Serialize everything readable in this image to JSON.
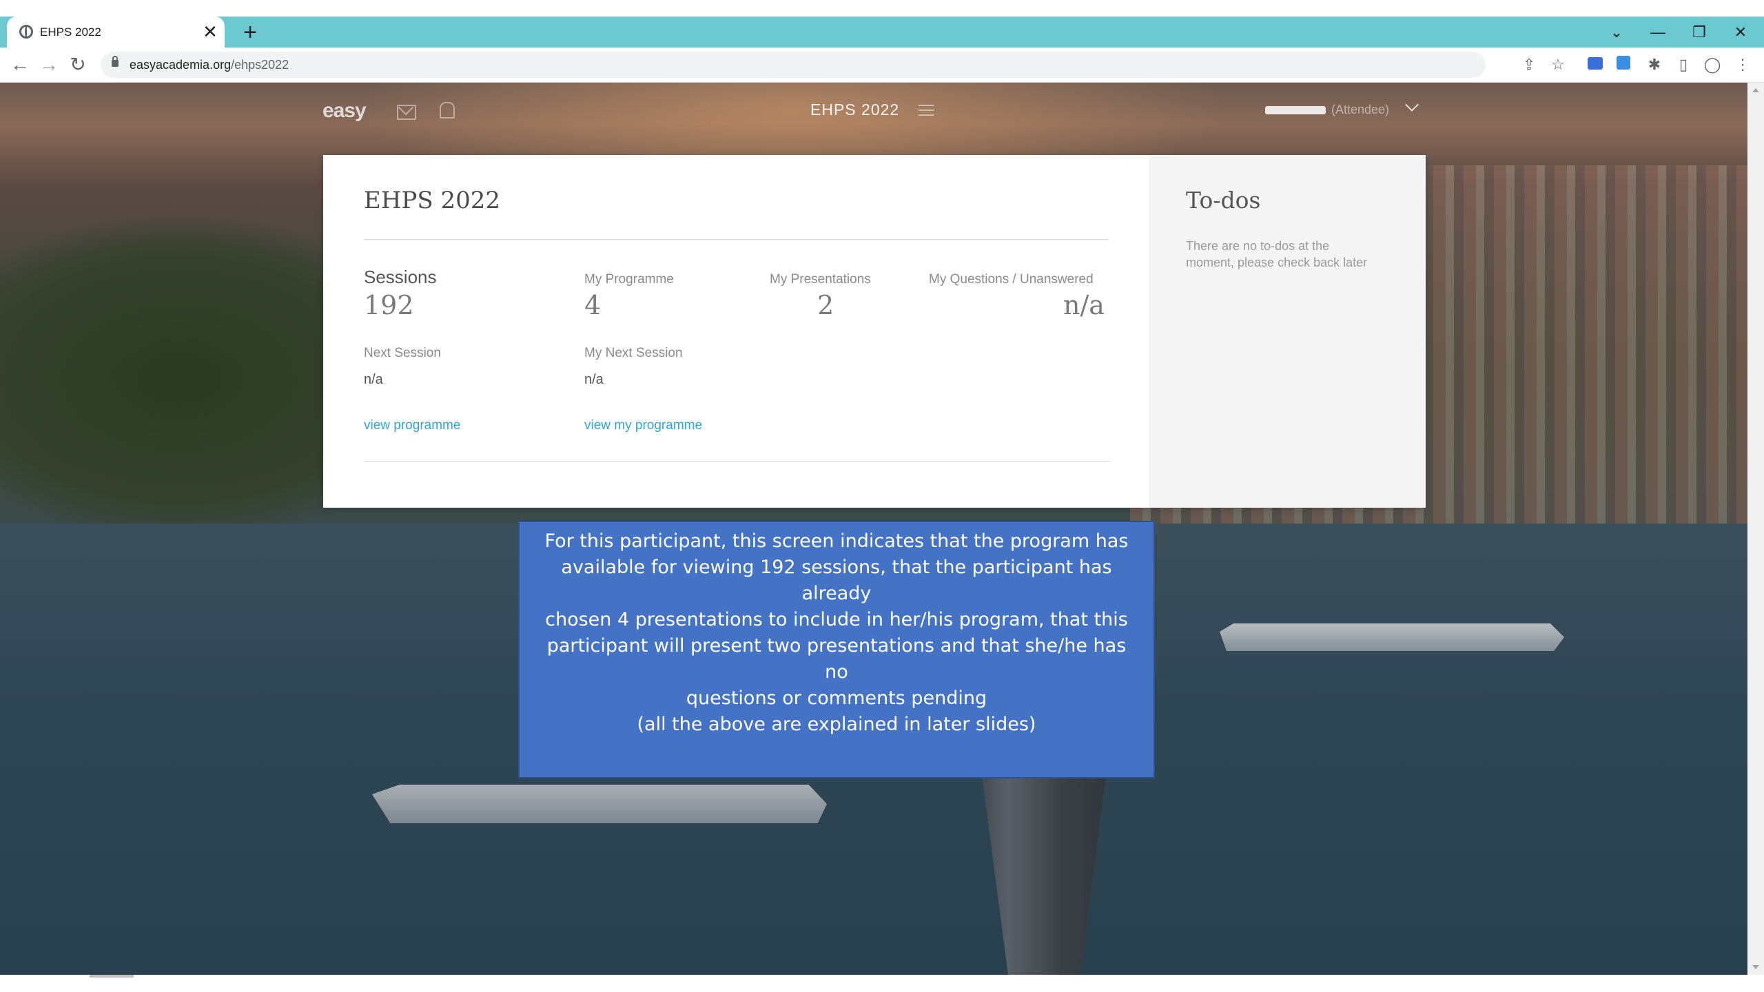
{
  "browser": {
    "tab_title": "EHPS 2022",
    "tab_close": "✕",
    "new_tab": "+",
    "url_domain": "easyacademia.org",
    "url_path": "/ehps2022",
    "back": "←",
    "forward": "→",
    "reload": "↻",
    "window_controls": {
      "dropdown": "⌄",
      "minimize": "—",
      "restore": "❐",
      "close": "✕"
    },
    "toolbar_icons": {
      "share": "⇪",
      "star": "☆",
      "puzzle": "✱",
      "sidebar": "▯",
      "profile": "◯",
      "more": "⋮"
    }
  },
  "header": {
    "logo": "easy",
    "event_name": "EHPS 2022",
    "user_role": "(Attendee)"
  },
  "card": {
    "title": "EHPS 2022",
    "stats": {
      "sessions_label": "Sessions",
      "sessions_value": "192",
      "programme_label": "My Programme",
      "programme_value": "4",
      "presentations_label": "My Presentations",
      "presentations_value": "2",
      "questions_label": "My Questions / Unanswered",
      "questions_value": "n/a"
    },
    "next_session_label": "Next Session",
    "next_session_value": "n/a",
    "my_next_session_label": "My Next Session",
    "my_next_session_value": "n/a",
    "view_programme": "view programme",
    "view_my_programme": "view my programme"
  },
  "todos": {
    "title": "To-dos",
    "empty_line1": "There are no to-dos at the",
    "empty_line2": "moment, please check back later"
  },
  "callout": {
    "lines": [
      "For this participant, this screen indicates that the program has",
      "available for viewing 192 sessions, that the participant has already",
      "chosen 4 presentations to include in her/his  program, that this",
      "participant will present two presentations and that she/he has no",
      "questions or comments pending",
      "(all the above are explained in later slides)"
    ]
  },
  "colors": {
    "tabbar": "#6cc9cf",
    "link": "#2fa6d6",
    "callout": "#4472c4"
  }
}
